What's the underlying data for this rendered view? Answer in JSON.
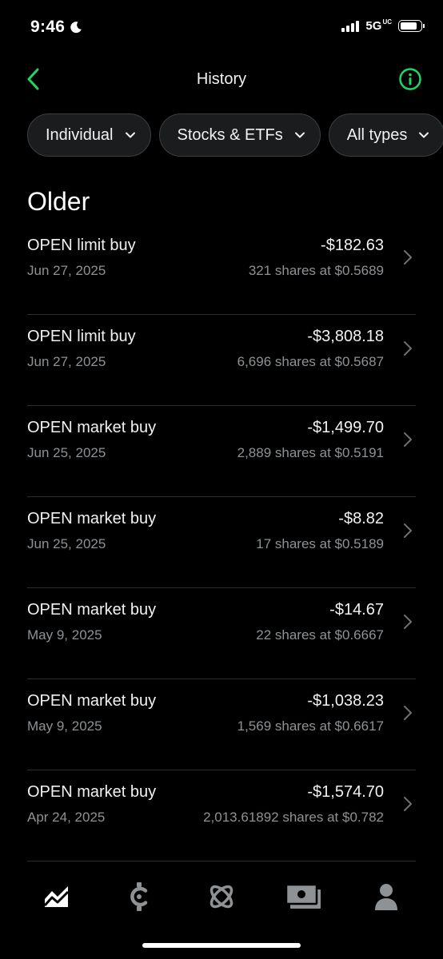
{
  "status_bar": {
    "time": "9:46",
    "network": "5G",
    "network_suffix": "UC"
  },
  "header": {
    "title": "History",
    "accent_color": "#1ed760"
  },
  "filters": [
    {
      "label": "Individual"
    },
    {
      "label": "Stocks & ETFs"
    },
    {
      "label": "All types"
    }
  ],
  "section": {
    "title": "Older"
  },
  "transactions": [
    {
      "title": "OPEN limit buy",
      "date": "Jun 27, 2025",
      "amount": "-$182.63",
      "detail": "321 shares at $0.5689"
    },
    {
      "title": "OPEN limit buy",
      "date": "Jun 27, 2025",
      "amount": "-$3,808.18",
      "detail": "6,696 shares at $0.5687"
    },
    {
      "title": "OPEN market buy",
      "date": "Jun 25, 2025",
      "amount": "-$1,499.70",
      "detail": "2,889 shares at $0.5191"
    },
    {
      "title": "OPEN market buy",
      "date": "Jun 25, 2025",
      "amount": "-$8.82",
      "detail": "17 shares at $0.5189"
    },
    {
      "title": "OPEN market buy",
      "date": "May 9, 2025",
      "amount": "-$14.67",
      "detail": "22 shares at $0.6667"
    },
    {
      "title": "OPEN market buy",
      "date": "May 9, 2025",
      "amount": "-$1,038.23",
      "detail": "1,569 shares at $0.6617"
    },
    {
      "title": "OPEN market buy",
      "date": "Apr 24, 2025",
      "amount": "-$1,574.70",
      "detail": "2,013.61892 shares at $0.782"
    }
  ],
  "bottom_nav": [
    {
      "icon": "chart-icon",
      "active": true
    },
    {
      "icon": "crypto-icon",
      "active": false
    },
    {
      "icon": "atom-icon",
      "active": false
    },
    {
      "icon": "cash-icon",
      "active": false
    },
    {
      "icon": "account-icon",
      "active": false
    }
  ]
}
